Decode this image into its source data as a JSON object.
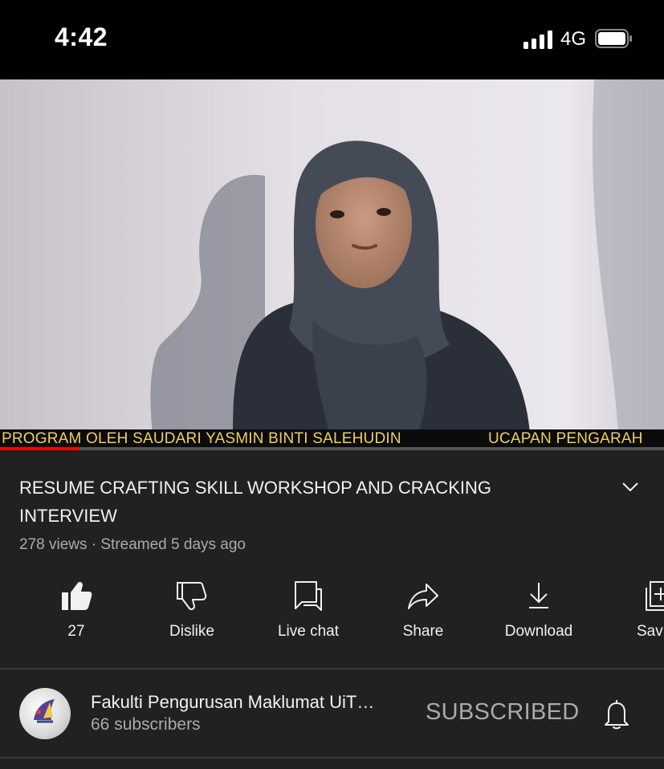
{
  "status_bar": {
    "time": "4:42",
    "network": "4G",
    "icons": [
      "signal-icon",
      "battery-icon"
    ]
  },
  "video": {
    "ticker_left": "PROGRAM OLEH SAUDARI YASMIN BINTI SALEHUDIN",
    "ticker_right": "UCAPAN PENGARAH",
    "progress_fraction": 0.12,
    "progress_color": "#ff0000"
  },
  "details": {
    "title_line1": "RESUME CRAFTING SKILL WORKSHOP AND CRACKING",
    "title_line2": "INTERVIEW",
    "meta": "278 views · Streamed 5 days ago"
  },
  "actions": [
    {
      "icon": "thumbs-up-icon",
      "label": "27"
    },
    {
      "icon": "thumbs-down-icon",
      "label": "Dislike"
    },
    {
      "icon": "live-chat-icon",
      "label": "Live chat"
    },
    {
      "icon": "share-icon",
      "label": "Share"
    },
    {
      "icon": "download-icon",
      "label": "Download"
    },
    {
      "icon": "save-icon",
      "label": "Sav"
    }
  ],
  "channel": {
    "name": "Fakulti Pengurusan Maklumat UiT…",
    "subscribers": "66 subscribers",
    "subscribe_state": "SUBSCRIBED"
  },
  "colors": {
    "background": "#212121",
    "status_bar": "#000000",
    "ticker_text": "#f0d060"
  }
}
